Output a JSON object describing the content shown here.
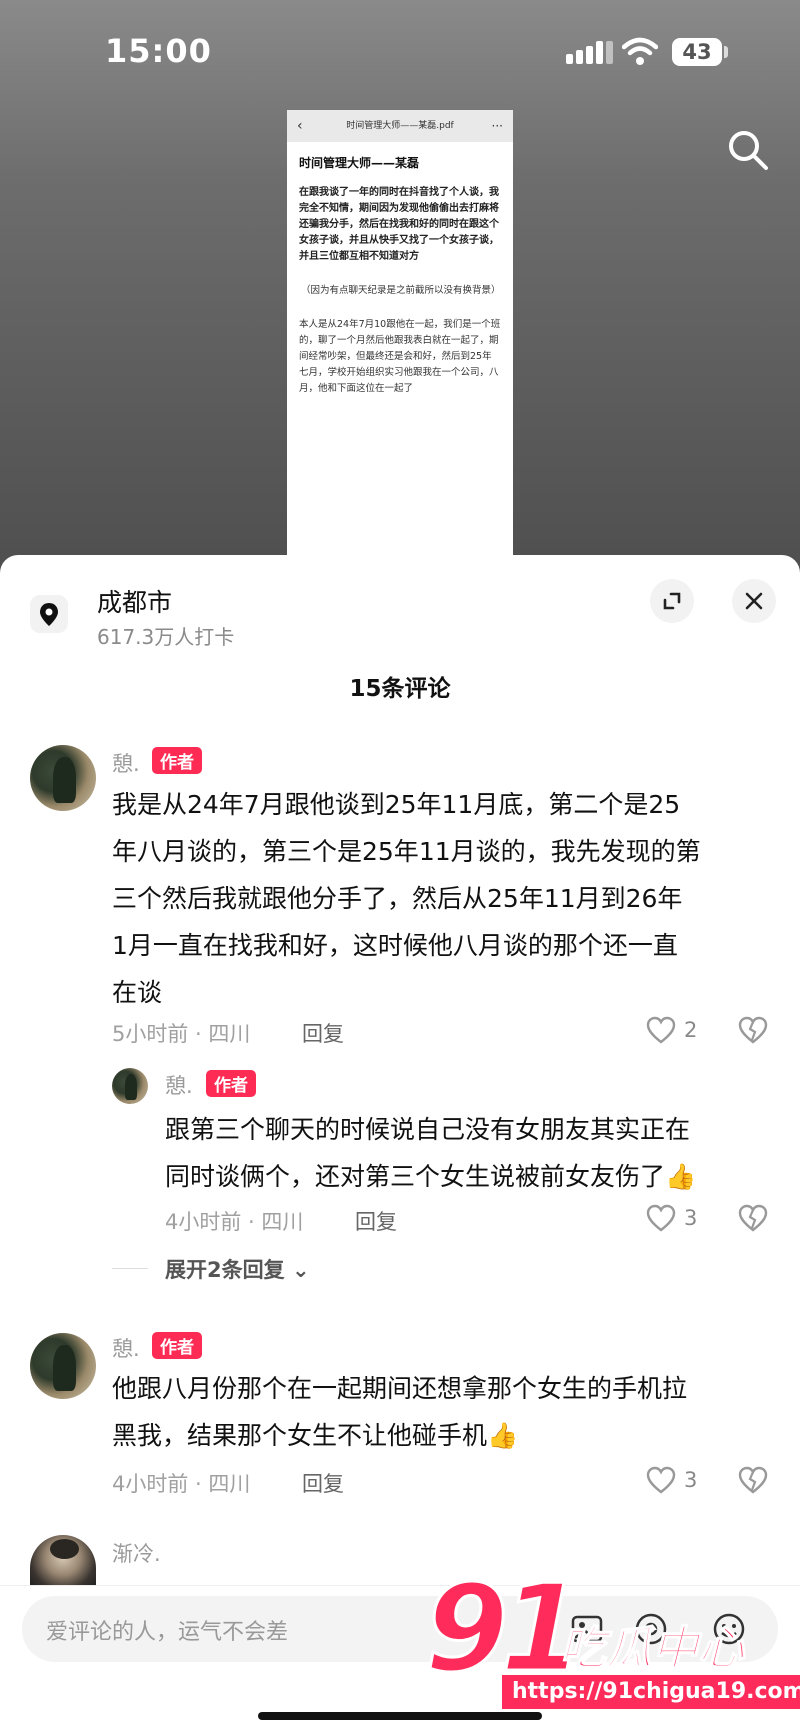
{
  "status": {
    "time": "15:00",
    "battery": "43"
  },
  "pdf": {
    "header_title": "时间管理大师——某磊.pdf",
    "title": "时间管理大师——某磊",
    "para1": "在跟我谈了一年的同时在抖音找了个人谈，我完全不知情，期间因为发现他偷偷出去打麻将还骗我分手，然后在找我和好的同时在跟这个女孩子谈，并且从快手又找了一个女孩子谈，并且三位都互相不知道对方",
    "note": "（因为有点聊天纪录是之前截所以没有换背景）",
    "para2": "本人是从24年7月10跟他在一起，我们是一个班的，聊了一个月然后他跟我表白就在一起了，期间经常吵架，但最终还是会和好，然后到25年七月，学校开始组织实习他跟我在一个公司，八月，他和下面这位在一起了"
  },
  "location": {
    "name": "成都市",
    "count": "617.3万人打卡"
  },
  "comments_header": "15条评论",
  "comments": [
    {
      "user": "憩.",
      "badge": "作者",
      "lines": [
        "我是从24年7月跟他谈到25年11月底，第二个是25",
        "年八月谈的，第三个是25年11月谈的，我先发现的第",
        "三个然后我就跟他分手了，然后从25年11月到26年",
        "1月一直在找我和好，这时候他八月谈的那个还一直",
        "在谈"
      ],
      "meta": "5小时前 · 四川",
      "reply": "回复",
      "likes": "2"
    },
    {
      "user": "憩.",
      "badge": "作者",
      "lines": [
        "跟第三个聊天的时候说自己没有女朋友其实正在",
        "同时谈俩个，还对第三个女生说被前女友伤了👍"
      ],
      "meta": "4小时前 · 四川",
      "reply": "回复",
      "likes": "3"
    },
    {
      "user": "憩.",
      "badge": "作者",
      "lines": [
        "他跟八月份那个在一起期间还想拿那个女生的手机拉",
        "黑我，结果那个女生不让他碰手机👍"
      ],
      "meta": "4小时前 · 四川",
      "reply": "回复",
      "likes": "3"
    },
    {
      "user": "渐冷."
    }
  ],
  "expand_replies": "展开2条回复",
  "input": {
    "placeholder": "爱评论的人，运气不会差"
  },
  "watermark": {
    "number": "91",
    "name": "吃瓜中心",
    "url": "https://91chigua19.com"
  },
  "colors": {
    "accent": "#fe2c55",
    "muted": "#a0a0a0"
  }
}
